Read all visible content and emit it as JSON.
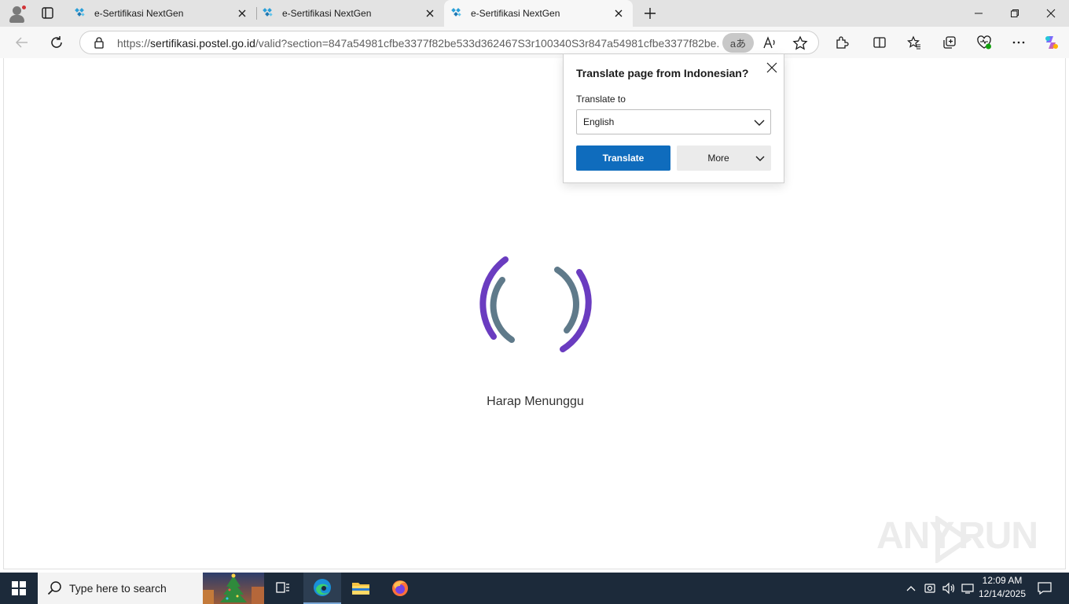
{
  "browser": {
    "tabs": [
      {
        "title": "e-Sertifikasi NextGen",
        "active": false
      },
      {
        "title": "e-Sertifikasi NextGen",
        "active": false
      },
      {
        "title": "e-Sertifikasi NextGen",
        "active": true
      }
    ],
    "address": {
      "scheme": "https://",
      "host": "sertifikasi.postel.go.id",
      "path": "/valid?section=847a54981cfbe3377f82be533d362467S3r100340S3r847a54981cfbe3377f82be...",
      "translate_glyph": "aあ"
    }
  },
  "translate_popup": {
    "title": "Translate page from Indonesian?",
    "label": "Translate to",
    "selected_language": "English",
    "translate_button": "Translate",
    "more_button": "More"
  },
  "page": {
    "loading_text": "Harap Menunggu",
    "spinner_colors": {
      "outer": "#6a3cc0",
      "inner": "#5f7a8a"
    }
  },
  "watermark": {
    "text_left": "ANY",
    "text_right": "RUN"
  },
  "taskbar": {
    "search_placeholder": "Type here to search",
    "time": "12:09 AM",
    "date": "12/14/2025"
  },
  "colors": {
    "accent": "#0f6cbd",
    "taskbar": "#1c2a3a"
  }
}
